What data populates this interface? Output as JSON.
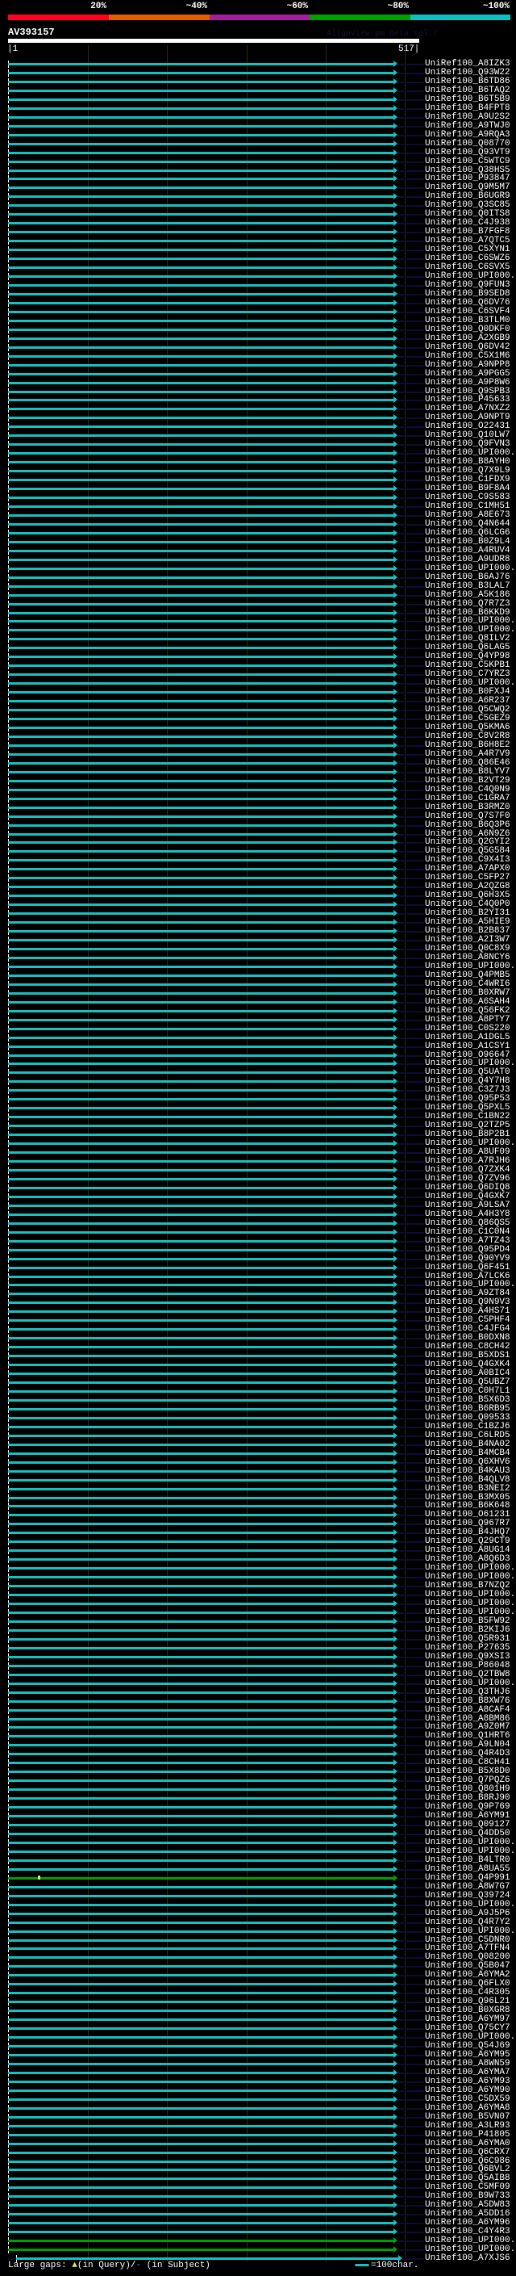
{
  "header": {
    "percent_labels": [
      "20%",
      "~40%",
      "~60%",
      "~80%",
      "~100%"
    ],
    "band_colors": [
      "#ff0020",
      "#e06000",
      "#a020a0",
      "#00a000",
      "#10c0c0"
    ],
    "query_id": "AV393157",
    "credit": "AlignView.pm Beta rel.7",
    "scale_start": "|1",
    "scale_end": "517|"
  },
  "colors": {
    "cyan": "#18c0c0",
    "green": "#00a000",
    "tail": "#0c0c34"
  },
  "green_rows": [
    206,
    247,
    248
  ],
  "rows": [
    "UniRef100_A8IZK3",
    "UniRef100_Q93W22",
    "UniRef100_B6TD86",
    "UniRef100_B6TAQ2",
    "UniRef100_B6T5B9",
    "UniRef100_B4FPT8",
    "UniRef100_A9U2S2",
    "UniRef100_A9TWJ0",
    "UniRef100_A9RQA3",
    "UniRef100_Q08770",
    "UniRef100_Q93VT9",
    "UniRef100_C5WTC9",
    "UniRef100_Q38HS5",
    "UniRef100_P93847",
    "UniRef100_Q9M5M7",
    "UniRef100_B6UGR9",
    "UniRef100_Q3SC85",
    "UniRef100_Q0ITS8",
    "UniRef100_C4J938",
    "UniRef100_B7FGF8",
    "UniRef100_A7QTC5",
    "UniRef100_C5XYN1",
    "UniRef100_C6SWZ6",
    "UniRef100_C6SVX5",
    "UniRef100_UPI000..",
    "UniRef100_Q9FUN3",
    "UniRef100_B9SED8",
    "UniRef100_Q6DV76",
    "UniRef100_C6SVF4",
    "UniRef100_B3TLM0",
    "UniRef100_Q0DKF0",
    "UniRef100_A2XGB9",
    "UniRef100_Q6DV42",
    "UniRef100_C5X1M6",
    "UniRef100_A9NPP8",
    "UniRef100_A9PGG5",
    "UniRef100_A9P8W6",
    "UniRef100_Q9SPB3",
    "UniRef100_P45633",
    "UniRef100_A7NXZ2",
    "UniRef100_A9NPT9",
    "UniRef100_O22431",
    "UniRef100_Q10LW7",
    "UniRef100_Q9FVN3",
    "UniRef100_UPI000..",
    "UniRef100_B8AYH0",
    "UniRef100_Q7X9L9",
    "UniRef100_C1FDX9",
    "UniRef100_B9F8A4",
    "UniRef100_C9S583",
    "UniRef100_C1MH51",
    "UniRef100_A8E673",
    "UniRef100_Q4N644",
    "UniRef100_Q6LCG6",
    "UniRef100_B0Z9L4",
    "UniRef100_A4RUV4",
    "UniRef100_A9UDR8",
    "UniRef100_UPI000..",
    "UniRef100_B6AJ76",
    "UniRef100_B3LAL7",
    "UniRef100_A5K186",
    "UniRef100_Q7R7Z3",
    "UniRef100_B6KKD9",
    "UniRef100_UPI000..",
    "UniRef100_UPI000..",
    "UniRef100_Q8ILV2",
    "UniRef100_Q6LAG5",
    "UniRef100_Q4YP98",
    "UniRef100_C5KPB1",
    "UniRef100_C7YRZ3",
    "UniRef100_UPI000..",
    "UniRef100_B0FXJ4",
    "UniRef100_A6R237",
    "UniRef100_Q5CWQ2",
    "UniRef100_C5GEZ9",
    "UniRef100_Q5KMA6",
    "UniRef100_C8V2R8",
    "UniRef100_B6H8E2",
    "UniRef100_A4R7V9",
    "UniRef100_Q86E46",
    "UniRef100_B8LYV7",
    "UniRef100_B2VT29",
    "UniRef100_C4Q0N9",
    "UniRef100_C1GRA7",
    "UniRef100_B3RMZ0",
    "UniRef100_Q7S7F0",
    "UniRef100_B6Q3P6",
    "UniRef100_A6N9Z6",
    "UniRef100_Q2GYI2",
    "UniRef100_Q5G584",
    "UniRef100_C9X4I3",
    "UniRef100_A7APX0",
    "UniRef100_C5FP27",
    "UniRef100_A2QZG8",
    "UniRef100_Q6H3X5",
    "UniRef100_C4Q0P0",
    "UniRef100_B2YI31",
    "UniRef100_A5HIE9",
    "UniRef100_B2B837",
    "UniRef100_A2I3W7",
    "UniRef100_Q0C8X9",
    "UniRef100_A8NCY6",
    "UniRef100_UPI000..",
    "UniRef100_Q4PMB5",
    "UniRef100_C4WRI6",
    "UniRef100_B0XRW7",
    "UniRef100_A6SAH4",
    "UniRef100_Q56FK2",
    "UniRef100_A8PTY7",
    "UniRef100_C0S220",
    "UniRef100_A1DGL5",
    "UniRef100_A1CSY1",
    "UniRef100_O96647",
    "UniRef100_UPI000..",
    "UniRef100_Q5UAT0",
    "UniRef100_Q4Y7H8",
    "UniRef100_C3Z7J3",
    "UniRef100_Q95P53",
    "UniRef100_Q5PXL5",
    "UniRef100_C1BN22",
    "UniRef100_Q2TZP5",
    "UniRef100_B8P2B1",
    "UniRef100_UPI000..",
    "UniRef100_A8UF09",
    "UniRef100_A7RJH6",
    "UniRef100_Q7ZXK4",
    "UniRef100_Q7ZV96",
    "UniRef100_Q6DIQ8",
    "UniRef100_Q4GXK7",
    "UniRef100_A9LSA7",
    "UniRef100_A4H3Y8",
    "UniRef100_Q86QS5",
    "UniRef100_C1C0N4",
    "UniRef100_A7TZ43",
    "UniRef100_Q95PD4",
    "UniRef100_Q90YV9",
    "UniRef100_Q6F451",
    "UniRef100_A7LCK6",
    "UniRef100_UPI000..",
    "UniRef100_A9ZT84",
    "UniRef100_Q9N9V3",
    "UniRef100_A4HS71",
    "UniRef100_C5PHF4",
    "UniRef100_C4JFG4",
    "UniRef100_B0DXN8",
    "UniRef100_C8CH42",
    "UniRef100_B5XDS1",
    "UniRef100_Q4GXK4",
    "UniRef100_A0BIC4",
    "UniRef100_Q5UBZ7",
    "UniRef100_C0H7L1",
    "UniRef100_B5X6D3",
    "UniRef100_B6RB95",
    "UniRef100_Q09533",
    "UniRef100_C1BZJ6",
    "UniRef100_C6LRD5",
    "UniRef100_B4NA02",
    "UniRef100_B4MCB4",
    "UniRef100_Q6XHV6",
    "UniRef100_B4KAU3",
    "UniRef100_B4QLV8",
    "UniRef100_B3NEI2",
    "UniRef100_B3MX05",
    "UniRef100_B6K648",
    "UniRef100_O61231",
    "UniRef100_Q967R7",
    "UniRef100_B4JHQ7",
    "UniRef100_Q29CT9",
    "UniRef100_A8UG14",
    "UniRef100_A8Q6D3",
    "UniRef100_UPI000..",
    "UniRef100_UPI000..",
    "UniRef100_B7NZQ2",
    "UniRef100_UPI000..",
    "UniRef100_UPI000..",
    "UniRef100_UPI000..",
    "UniRef100_B5FW92",
    "UniRef100_B2KIJ6",
    "UniRef100_Q5R931",
    "UniRef100_P27635",
    "UniRef100_Q9XSI3",
    "UniRef100_P86048",
    "UniRef100_Q2TBW8",
    "UniRef100_UPI000..",
    "UniRef100_Q3THJ6",
    "UniRef100_B8XW76",
    "UniRef100_A8CAF4",
    "UniRef100_A8BM86",
    "UniRef100_A9Z0M7",
    "UniRef100_Q1HRT6",
    "UniRef100_A9LN04",
    "UniRef100_Q4R4D3",
    "UniRef100_C8CH41",
    "UniRef100_B5X8D0",
    "UniRef100_Q7PQZ6",
    "UniRef100_Q801H9",
    "UniRef100_B8RJ90",
    "UniRef100_Q9P769",
    "UniRef100_A6YM91",
    "UniRef100_Q09127",
    "UniRef100_Q4DD50",
    "UniRef100_UPI000..",
    "UniRef100_UPI000..",
    "UniRef100_B4LTR0",
    "UniRef100_A8UA55",
    "UniRef100_Q4P991",
    "UniRef100_A8W7G7",
    "UniRef100_Q39724",
    "UniRef100_UPI000..",
    "UniRef100_A9J5P6",
    "UniRef100_Q4R7Y2",
    "UniRef100_UPI000..",
    "UniRef100_C5DNR0",
    "UniRef100_A7TFN4",
    "UniRef100_Q08200",
    "UniRef100_Q5B047",
    "UniRef100_A6YMA2",
    "UniRef100_Q6FLX0",
    "UniRef100_C4R305",
    "UniRef100_Q96L21",
    "UniRef100_B0XGR8",
    "UniRef100_A6YM97",
    "UniRef100_Q75CY7",
    "UniRef100_UPI000..",
    "UniRef100_Q54J69",
    "UniRef100_A6YM95",
    "UniRef100_A8WN59",
    "UniRef100_A6YMA7",
    "UniRef100_A6YM93",
    "UniRef100_A6YM90",
    "UniRef100_C5DX59",
    "UniRef100_A6YMA8",
    "UniRef100_B5VN07",
    "UniRef100_A3LR93",
    "UniRef100_P41805",
    "UniRef100_A6YMA0",
    "UniRef100_Q6CRX7",
    "UniRef100_Q6C986",
    "UniRef100_Q6BVL2",
    "UniRef100_Q5AIB8",
    "UniRef100_C5MF09",
    "UniRef100_B9W733",
    "UniRef100_A5DW83",
    "UniRef100_A5DD16",
    "UniRef100_A6YM96",
    "UniRef100_C4Y4R3",
    "UniRef100_UPI000..",
    "UniRef100_UPI000..",
    "UniRef100_A7XJS6"
  ],
  "legend": {
    "prefix": "Large gaps:",
    "query_symbol": "▲",
    "query_text": "(in Query)/",
    "subject_symbol": "-",
    "subject_text": " (in Subject)",
    "scale_text": "=100char."
  }
}
